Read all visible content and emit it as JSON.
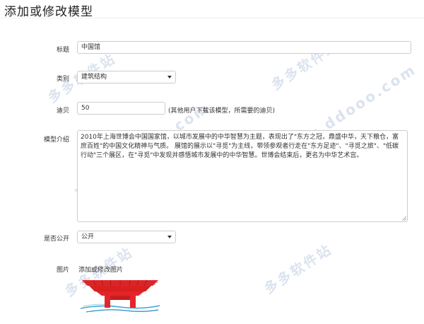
{
  "page": {
    "title": "添加或修改模型"
  },
  "form": {
    "title_label": "标题",
    "title_value": "中国馆",
    "category_label": "类别",
    "category_value": "建筑结构",
    "points_label": "迪贝",
    "points_value": "50",
    "points_hint": "(其他用户下载该模型，所需要的迪贝)",
    "intro_label": "模型介绍",
    "intro_text": "2010年上海世博会中国国家馆，以城市发展中的中华智慧为主题，表现出了\"东方之冠，鼎盛中华，天下粮仓，富庶百姓\"的中国文化精神与气质。 展馆的展示以\"寻觅\"为主线，带领参观者行走在\"东方足迹\"、\"寻觅之旅\"、\"低碳行动\"三个展区，在\"寻觅\"中发现并感悟城市发展中的中华智慧。世博会结束后，更名为中华艺术宫。",
    "public_label": "是否公开",
    "public_value": "公开",
    "image_label": "图片",
    "image_link": "添加或修改图片"
  },
  "watermarks": {
    "brand": "多多软件站",
    "url": "www.ddooo.com"
  },
  "colors": {
    "pavilion_red": "#e3262b",
    "watermark": "#dbe3ef",
    "border": "#cccccc"
  }
}
